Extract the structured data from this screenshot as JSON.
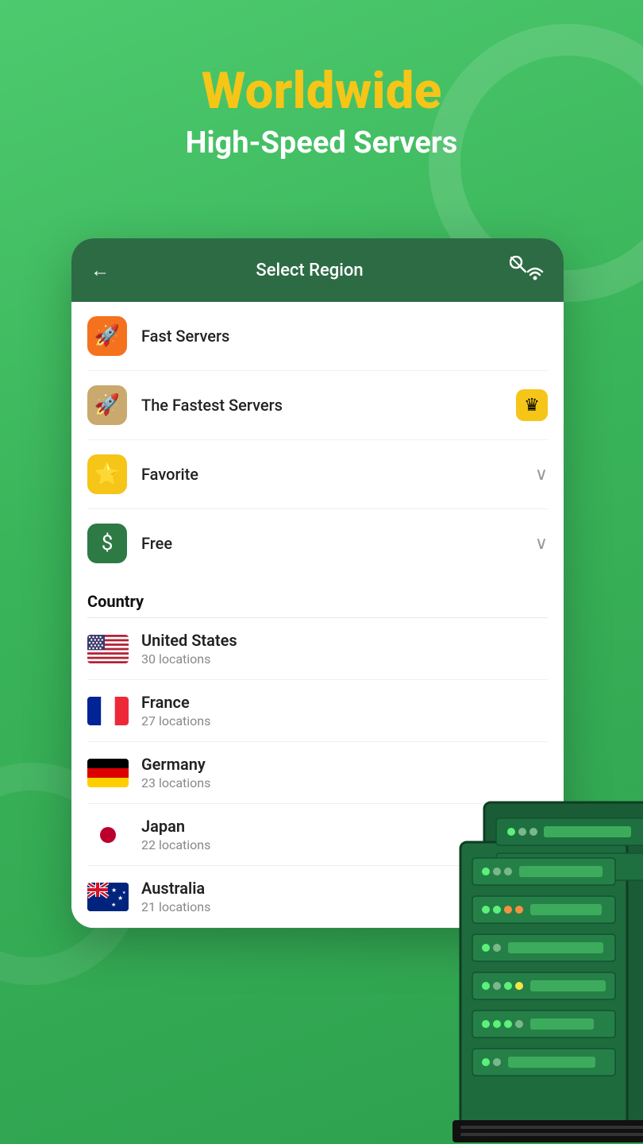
{
  "header": {
    "title": "Worldwide",
    "subtitle": "High-Speed Servers"
  },
  "card": {
    "header_title": "Select Region",
    "back_label": "←"
  },
  "menu_items": [
    {
      "id": "fast-servers",
      "label": "Fast Servers",
      "icon_type": "orange",
      "icon": "🚀",
      "has_crown": false,
      "has_chevron": false
    },
    {
      "id": "fastest-servers",
      "label": "The Fastest Servers",
      "icon_type": "tan",
      "icon": "🚀",
      "has_crown": true,
      "has_chevron": false
    },
    {
      "id": "favorite",
      "label": "Favorite",
      "icon_type": "yellow",
      "icon": "⭐",
      "has_crown": false,
      "has_chevron": true
    },
    {
      "id": "free",
      "label": "Free",
      "icon_type": "green-dark",
      "icon": "💲",
      "has_crown": false,
      "has_chevron": true
    }
  ],
  "country_section_label": "Country",
  "countries": [
    {
      "name": "United States",
      "locations": "30 locations",
      "flag": "us"
    },
    {
      "name": "France",
      "locations": "27 locations",
      "flag": "fr"
    },
    {
      "name": "Germany",
      "locations": "23 locations",
      "flag": "de"
    },
    {
      "name": "Japan",
      "locations": "22 locations",
      "flag": "jp"
    },
    {
      "name": "Australia",
      "locations": "21 locations",
      "flag": "au"
    }
  ],
  "icons": {
    "back": "←",
    "chevron_down": "∨",
    "crown": "♛"
  },
  "colors": {
    "bg_green": "#3ab55a",
    "card_header": "#2d6b45",
    "title_yellow": "#f5c518",
    "title_white": "#ffffff"
  }
}
